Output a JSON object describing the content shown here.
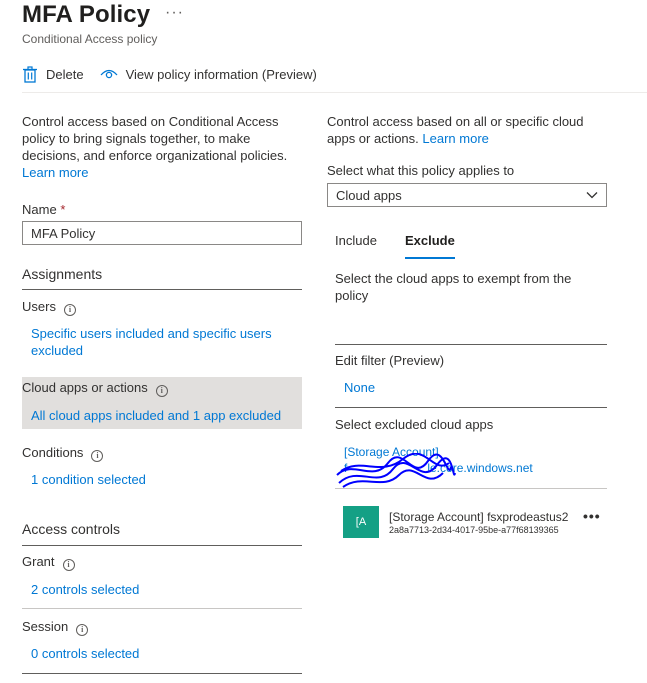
{
  "header": {
    "title": "MFA Policy",
    "more": "···",
    "subtitle": "Conditional Access policy"
  },
  "toolbar": {
    "delete_label": "Delete",
    "view_info_label": "View policy information (Preview)"
  },
  "left": {
    "description": "Control access based on Conditional Access policy to bring signals together, to make decisions, and enforce organizational policies.",
    "learn_more": "Learn more",
    "name_label": "Name",
    "name_required": "*",
    "name_value": "MFA Policy",
    "assignments_heading": "Assignments",
    "users_label": "Users",
    "users_link": "Specific users included and specific users excluded",
    "cloud_apps_label": "Cloud apps or actions",
    "cloud_apps_link": "All cloud apps included and 1 app excluded",
    "conditions_label": "Conditions",
    "conditions_link": "1 condition selected",
    "access_controls_heading": "Access controls",
    "grant_label": "Grant",
    "grant_link": "2 controls selected",
    "session_label": "Session",
    "session_link": "0 controls selected"
  },
  "right": {
    "description": "Control access based on all or specific cloud apps or actions.",
    "learn_more": "Learn more",
    "applies_label": "Select what this policy applies to",
    "applies_value": "Cloud apps",
    "tabs": [
      {
        "label": "Include"
      },
      {
        "label": "Exclude"
      }
    ],
    "exclude_desc": "Select the cloud apps to exempt from the policy",
    "edit_filter_label": "Edit filter (Preview)",
    "edit_filter_value": "None",
    "select_excluded_label": "Select excluded cloud apps",
    "excluded_link_line1": "[Storage Account]",
    "excluded_link_line2": "f",
    "excluded_link_line2_end": "le.core.windows.net",
    "app_icon_text": "[A",
    "app_name": "[Storage Account] fsxprodeastus2",
    "app_id": "2a8a7713-2d34-4017-95be-a77f68139365",
    "app_more": "•••"
  },
  "colors": {
    "accent": "#0078d4",
    "app_icon_bg": "#14a085",
    "selected_row_bg": "#e1dfdd",
    "scribble": "#0000ff"
  }
}
